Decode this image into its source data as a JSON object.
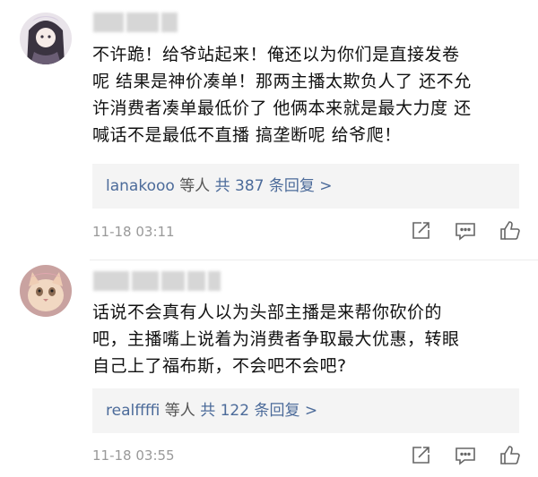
{
  "comments": [
    {
      "text_lines": [
        "不许跪！给爷站起来！俺还以为你们是直接发卷",
        "呢 结果是神价凑单！那两主播太欺负人了 还不允",
        "许消费者凑单最低价了 他俩本来就是最大力度 还",
        "喊话不是最低不直播 搞垄断呢 给爷爬！"
      ],
      "reply_user": "lanakooo",
      "reply_etc": "等人",
      "reply_count_label": "共 387 条回复 >",
      "timestamp": "11-18 03:11"
    },
    {
      "text_lines": [
        "话说不会真有人以为头部主播是来帮你砍价的",
        "吧，主播嘴上说着为消费者争取最大优惠，转眼",
        "自己上了福布斯，不会吧不会吧?"
      ],
      "reply_user": "realffffi",
      "reply_etc": "等人",
      "reply_count_label": "共 122 条回复 >",
      "timestamp": "11-18 03:55"
    }
  ],
  "icons": [
    "share-icon",
    "comment-icon",
    "like-icon"
  ],
  "colors": {
    "link": "#4c6b9a",
    "reply_bg": "#f4f4f4",
    "time": "#999999"
  }
}
